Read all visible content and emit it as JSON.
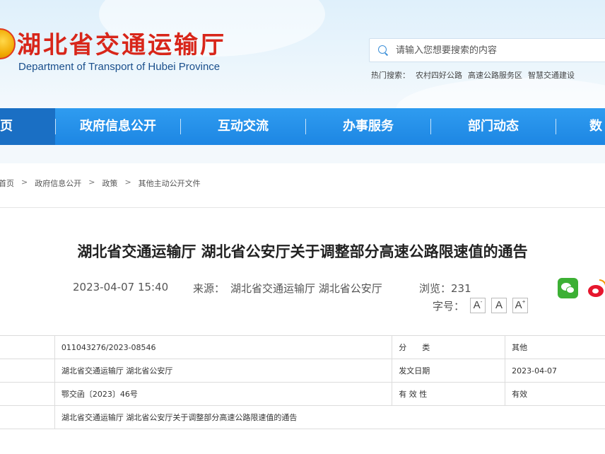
{
  "header": {
    "site_title": "湖北省交通运输厅",
    "site_subtitle": "Department of Transport of Hubei Province",
    "search_placeholder": "请输入您想要搜索的内容",
    "hot_search_label": "热门搜索：",
    "hot_search_items": [
      "农村四好公路",
      "高速公路服务区",
      "智慧交通建设"
    ]
  },
  "nav": {
    "items": [
      "页",
      "政府信息公开",
      "互动交流",
      "办事服务",
      "部门动态",
      "数"
    ]
  },
  "breadcrumb": {
    "items": [
      "首页",
      "政府信息公开",
      "政策",
      "其他主动公开文件"
    ],
    "separator": ">"
  },
  "article": {
    "title": "湖北省交通运输厅 湖北省公安厅关于调整部分高速公路限速值的通告",
    "date": "2023-04-07 15:40",
    "source_label": "来源：",
    "source": "湖北省交通运输厅 湖北省公安厅",
    "views_label": "浏览：",
    "views": "231",
    "fontsize_label": "字号：",
    "fontsize_buttons": [
      "A",
      "A",
      "A"
    ]
  },
  "share": {
    "icons": [
      "wechat-icon",
      "weibo-icon"
    ],
    "colors": {
      "wechat": "#3cb034",
      "weibo": "#e6162d"
    }
  },
  "info_table": {
    "rows": [
      {
        "value": "011043276/2023-08546",
        "label2": "分　　类",
        "value2": "其他"
      },
      {
        "value": "湖北省交通运输厅 湖北省公安厅",
        "label2": "发文日期",
        "value2": "2023-04-07"
      },
      {
        "value": "鄂交函〔2023〕46号",
        "label2": "有 效 性",
        "value2": "有效"
      },
      {
        "value": "湖北省交通运输厅 湖北省公安厅关于调整部分高速公路限速值的通告",
        "label2": "",
        "value2": ""
      }
    ]
  },
  "colors": {
    "nav_bg": "#1d86e3",
    "title_red": "#d8261a",
    "subtitle_blue": "#1a4f8c"
  }
}
